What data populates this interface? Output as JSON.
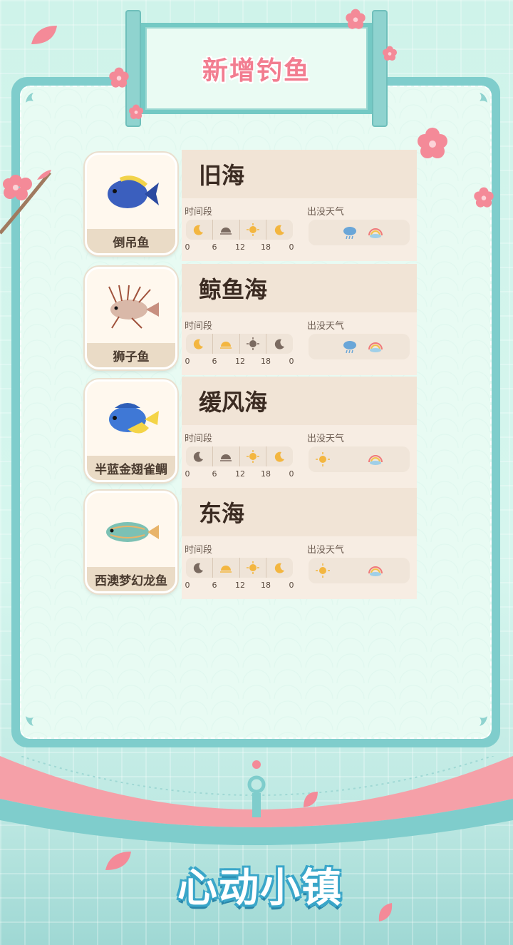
{
  "banner": {
    "title": "新增钓鱼"
  },
  "labels": {
    "time": "时间段",
    "weather": "出没天气"
  },
  "ticks": [
    "0",
    "6",
    "12",
    "18",
    "0"
  ],
  "fish": [
    {
      "name": "倒吊鱼",
      "sea": "旧海",
      "time_slots": [
        "night-moon-icon",
        "dawn-icon",
        "sun-icon",
        "night-moon-icon"
      ],
      "weather": [
        "rain-cloud-icon",
        "rainbow-icon"
      ],
      "body_color": "#3b5fbe",
      "fin_color": "#f2d34a"
    },
    {
      "name": "狮子鱼",
      "sea": "鲸鱼海",
      "time_slots": [
        "night-moon-icon",
        "dawn-icon",
        "dim-sun-icon",
        "moon-icon"
      ],
      "weather": [
        "rain-cloud-icon",
        "rainbow-icon"
      ],
      "body_color": "#d9b8a8",
      "fin_color": "#a0523c"
    },
    {
      "name": "半蓝金翅雀鲷",
      "sea": "缓风海",
      "time_slots": [
        "night-moon-icon",
        "dawn-icon",
        "sun-icon",
        "night-moon-icon"
      ],
      "weather": [
        "sun-icon",
        "rainbow-icon"
      ],
      "body_color": "#3f78d6",
      "fin_color": "#f4d447"
    },
    {
      "name": "西澳梦幻龙鱼",
      "sea": "东海",
      "time_slots": [
        "night-moon-icon",
        "dawn-icon",
        "sun-icon",
        "night-moon-icon"
      ],
      "weather": [
        "sun-icon",
        "rainbow-icon"
      ],
      "body_color": "#7cc1b4",
      "fin_color": "#e8b46a"
    }
  ],
  "logo": {
    "text": "心动小镇"
  },
  "colors": {
    "accent_pink": "#f27d90",
    "teal": "#7fcdcc",
    "card": "#f7ede3"
  }
}
